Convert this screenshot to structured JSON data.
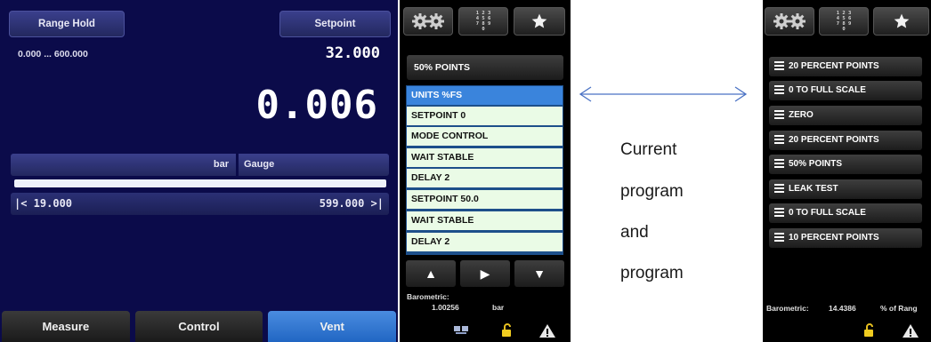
{
  "main": {
    "range_hold_label": "Range Hold",
    "setpoint_label": "Setpoint",
    "range_text": "0.000 ... 600.000",
    "setpoint_value": "32.000",
    "reading": "0.006",
    "unit": "bar",
    "mode": "Gauge",
    "bar_fraction": 0.0,
    "lower_limit": "|<  19.000",
    "upper_limit": "599.000  >|",
    "tabs": [
      {
        "label": "Measure"
      },
      {
        "label": "Control"
      },
      {
        "label": "Vent"
      }
    ]
  },
  "program_panel": {
    "program_name": "50% POINTS",
    "steps": [
      {
        "label": "UNITS %FS"
      },
      {
        "label": "SETPOINT 0"
      },
      {
        "label": "MODE CONTROL"
      },
      {
        "label": "WAIT STABLE"
      },
      {
        "label": "DELAY 2"
      },
      {
        "label": "SETPOINT 50.0"
      },
      {
        "label": "WAIT STABLE"
      },
      {
        "label": "DELAY 2"
      }
    ],
    "barometric_label": "Barometric:",
    "barometric_value": "1.00256",
    "barometric_unit": "bar"
  },
  "program_list_panel": {
    "items": [
      {
        "label": "20 PERCENT POINTS"
      },
      {
        "label": "0 TO FULL SCALE"
      },
      {
        "label": "ZERO"
      },
      {
        "label": "20 PERCENT POINTS"
      },
      {
        "label": "50% POINTS"
      },
      {
        "label": "LEAK TEST"
      },
      {
        "label": "0 TO FULL SCALE"
      },
      {
        "label": "10 PERCENT POINTS"
      }
    ],
    "barometric_label": "Barometric:",
    "barometric_value": "14.4386",
    "barometric_unit": "% of Rang"
  },
  "annotation": {
    "caption_lines": [
      "Current",
      "program",
      "and",
      "program"
    ]
  },
  "colors": {
    "main_background": "#0b0b4a",
    "active_tab": "#2166c3",
    "selected_step": "#3a84dc",
    "step_background": "#eafbe6",
    "arrow_color": "#4a72c4"
  },
  "icons": [
    "gears-icon",
    "numpad-icon",
    "star-icon",
    "arrow-up-icon",
    "arrow-right-icon",
    "arrow-down-icon",
    "network-icon",
    "unlock-icon",
    "warning-icon",
    "hamburger-icon",
    "double-arrow-icon"
  ]
}
